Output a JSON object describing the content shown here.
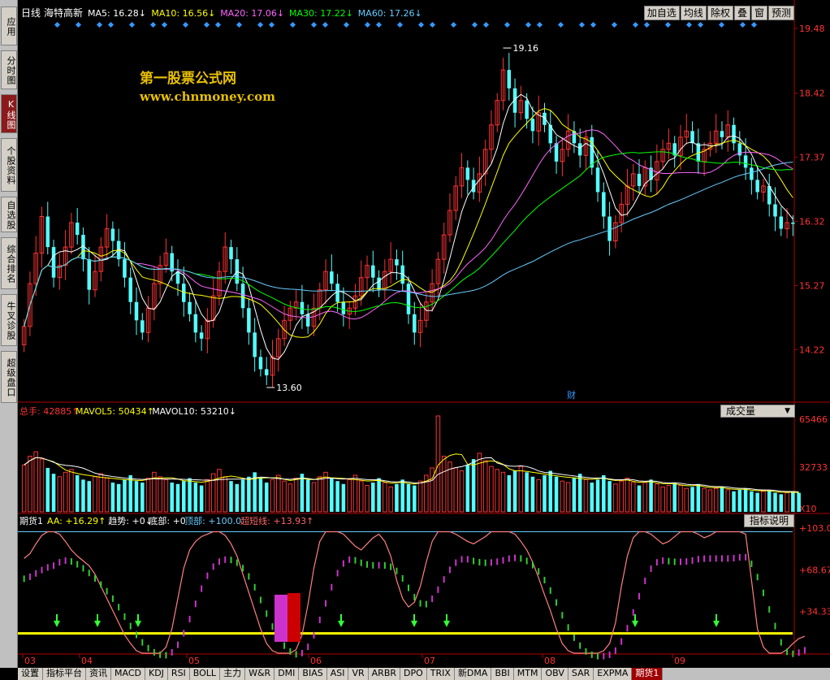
{
  "sidebar": {
    "items": [
      {
        "label": "应用",
        "active": false
      },
      {
        "label": "分时图",
        "active": false
      },
      {
        "label": "K线图",
        "active": true
      },
      {
        "label": "个股资料",
        "active": false
      },
      {
        "label": "自选股",
        "active": false
      },
      {
        "label": "综合排名",
        "active": false
      },
      {
        "label": "牛叉诊股",
        "active": false
      },
      {
        "label": "超级盘口",
        "active": false
      }
    ]
  },
  "header": {
    "period": "日线",
    "stock_name": "海特高新",
    "ma": [
      {
        "label": "MA5: 16.28↓",
        "color": "#ffffff"
      },
      {
        "label": "MA10: 16.56↓",
        "color": "#ffff00"
      },
      {
        "label": "MA20: 17.06↓",
        "color": "#ff66ff"
      },
      {
        "label": "MA30: 17.22↓",
        "color": "#00ff00"
      },
      {
        "label": "MA60: 17.26↓",
        "color": "#66ccff"
      }
    ]
  },
  "toolbar": {
    "buttons": [
      "加自选",
      "均线",
      "除权",
      "叠",
      "窗",
      "预测"
    ]
  },
  "watermark": {
    "title": "第一股票公式网",
    "url": "www.chnmoney.com"
  },
  "main_chart": {
    "price_labels": [
      "19.48",
      "18.42",
      "17.37",
      "16.32",
      "15.27",
      "14.22"
    ],
    "high_label": "19.16",
    "low_label": "13.60",
    "finance_marker": "财"
  },
  "volume_panel": {
    "legend": [
      {
        "label": "总手: 42885↑",
        "color": "#ff3333"
      },
      {
        "label": "MAVOL5: 50434↑",
        "color": "#ffff00"
      },
      {
        "label": "MAVOL10: 53210↓",
        "color": "#ffffff"
      }
    ],
    "selector": "成交量",
    "axis_labels": [
      "65466",
      "32733",
      "X10"
    ]
  },
  "indicator_panel": {
    "name": "期货1",
    "legend": [
      {
        "label": "AA: +16.29↑",
        "color": "#ffff00"
      },
      {
        "label": "趋势: +0↓",
        "color": "#ffffff"
      },
      {
        "label": "底部: +0",
        "color": "#ffffff"
      },
      {
        "label": "顶部: +100.0",
        "color": "#66ccff"
      },
      {
        "label": "超短线: +13.93↑",
        "color": "#ff6666"
      }
    ],
    "button": "指标说明",
    "axis_labels": [
      "+103.0",
      "+68.67",
      "+34.33"
    ]
  },
  "x_axis": {
    "months": [
      "03",
      "04",
      "05",
      "06",
      "07",
      "08",
      "09"
    ]
  },
  "bottom_tabs": [
    "设置",
    "指标平台",
    "资讯",
    "MACD",
    "KDJ",
    "RSI",
    "BOLL",
    "主力",
    "W&R",
    "DMI",
    "BIAS",
    "ASI",
    "VR",
    "ARBR",
    "DPO",
    "TRIX",
    "新DMA",
    "BBI",
    "MTM",
    "OBV",
    "SAR",
    "EXPMA",
    "期货1"
  ],
  "active_tab": "期货1",
  "colors": {
    "up": "#ff3333",
    "down": "#54ffff",
    "axis": "#b00000",
    "grid": "#550000"
  },
  "chart_data": {
    "type": "candlestick",
    "title": "海特高新",
    "x_months": [
      "03",
      "04",
      "05",
      "06",
      "07",
      "08",
      "09"
    ],
    "ylim": [
      13.4,
      19.6
    ],
    "y_ticks": [
      14.22,
      15.27,
      16.32,
      17.37,
      18.42,
      19.48
    ],
    "annotations": [
      {
        "text": "19.16",
        "value": 19.16
      },
      {
        "text": "13.60",
        "value": 13.6
      }
    ],
    "close": [
      14.6,
      15.3,
      15.8,
      16.4,
      15.9,
      15.4,
      15.6,
      15.9,
      16.3,
      16.1,
      15.7,
      15.2,
      15.5,
      15.9,
      16.2,
      16.0,
      15.7,
      15.4,
      15.0,
      14.7,
      14.5,
      14.9,
      15.3,
      15.6,
      15.8,
      15.5,
      15.3,
      15.0,
      14.8,
      14.5,
      14.4,
      14.7,
      15.1,
      15.5,
      15.9,
      15.7,
      15.3,
      14.9,
      14.5,
      14.1,
      13.9,
      13.8,
      14.1,
      14.4,
      14.7,
      14.9,
      15.0,
      14.8,
      14.6,
      14.9,
      15.2,
      15.5,
      15.3,
      15.0,
      14.8,
      14.9,
      15.1,
      15.4,
      15.6,
      15.4,
      15.2,
      15.5,
      15.7,
      15.6,
      15.3,
      14.8,
      14.5,
      14.7,
      15.0,
      15.3,
      15.7,
      16.1,
      16.5,
      16.9,
      17.2,
      17.0,
      16.8,
      17.1,
      17.5,
      17.9,
      18.3,
      18.8,
      18.5,
      18.1,
      18.3,
      18.0,
      17.8,
      18.1,
      17.9,
      17.6,
      17.3,
      17.5,
      17.8,
      17.6,
      17.4,
      17.7,
      17.2,
      16.8,
      16.4,
      16.0,
      16.3,
      16.6,
      16.9,
      17.1,
      16.9,
      17.2,
      17.0,
      17.3,
      17.5,
      17.6,
      17.4,
      17.7,
      17.8,
      17.6,
      17.3,
      17.5,
      17.6,
      17.8,
      17.7,
      17.9,
      17.6,
      17.4,
      17.2,
      17.0,
      16.8,
      16.9,
      16.6,
      16.4,
      16.2,
      16.3,
      16.28
    ],
    "volume": [
      32000,
      38000,
      41000,
      36000,
      30000,
      26000,
      24000,
      27000,
      29000,
      25000,
      22000,
      21000,
      24000,
      26000,
      23000,
      20000,
      19000,
      22000,
      25000,
      21000,
      20000,
      23000,
      27000,
      24000,
      22000,
      20000,
      19000,
      21000,
      23000,
      20000,
      18000,
      22000,
      26000,
      29000,
      24000,
      21000,
      19000,
      22000,
      24000,
      27000,
      23000,
      20000,
      22000,
      25000,
      21000,
      19000,
      23000,
      26000,
      22000,
      20000,
      24000,
      27000,
      23000,
      21000,
      19000,
      22000,
      25000,
      21000,
      18000,
      20000,
      23000,
      20000,
      17000,
      19000,
      22000,
      19000,
      18000,
      21000,
      25000,
      30000,
      65466,
      38000,
      34000,
      30000,
      28000,
      32000,
      36000,
      40000,
      35000,
      31000,
      29000,
      27000,
      25000,
      28000,
      31000,
      27000,
      24000,
      22000,
      25000,
      28000,
      24000,
      21000,
      20000,
      23000,
      26000,
      22000,
      20000,
      22000,
      25000,
      21000,
      19000,
      21000,
      23000,
      20000,
      18000,
      20000,
      22000,
      19000,
      17000,
      18000,
      20000,
      18000,
      16000,
      17000,
      19000,
      16000,
      15000,
      16000,
      17000,
      15000,
      14000,
      15000,
      16000,
      14000,
      13000,
      14000,
      15000,
      13000,
      12000,
      13000,
      14000,
      13000
    ],
    "mavol5": [
      30000,
      29000,
      28000,
      24000,
      22000,
      26000,
      28000
    ],
    "indicator_top": 100.0,
    "indicator_line": [
      78,
      82,
      90,
      97,
      100,
      100,
      98,
      92,
      85,
      80,
      76,
      72,
      65,
      55,
      45,
      35,
      25,
      15,
      8,
      2,
      0,
      0,
      0,
      0,
      5,
      20,
      45,
      70,
      85,
      92,
      96,
      98,
      100,
      100,
      97,
      90,
      80,
      65,
      50,
      35,
      20,
      8,
      2,
      0,
      0,
      0,
      3,
      15,
      40,
      70,
      92,
      100,
      100,
      100,
      98,
      93,
      88,
      85,
      90,
      95,
      98,
      92,
      80,
      60,
      45,
      38,
      42,
      55,
      75,
      92,
      100,
      100,
      100,
      98,
      95,
      92,
      90,
      93,
      96,
      100,
      100,
      100,
      100,
      98,
      92,
      85,
      75,
      62,
      48,
      35,
      20,
      8,
      2,
      0,
      0,
      0,
      0,
      0,
      2,
      8,
      25,
      55,
      80,
      95,
      100,
      100,
      98,
      94,
      90,
      92,
      96,
      100,
      100,
      100,
      98,
      95,
      97,
      100,
      100,
      100,
      100,
      100,
      98,
      60,
      20,
      5,
      0,
      0,
      0,
      3,
      8,
      12,
      14
    ]
  }
}
